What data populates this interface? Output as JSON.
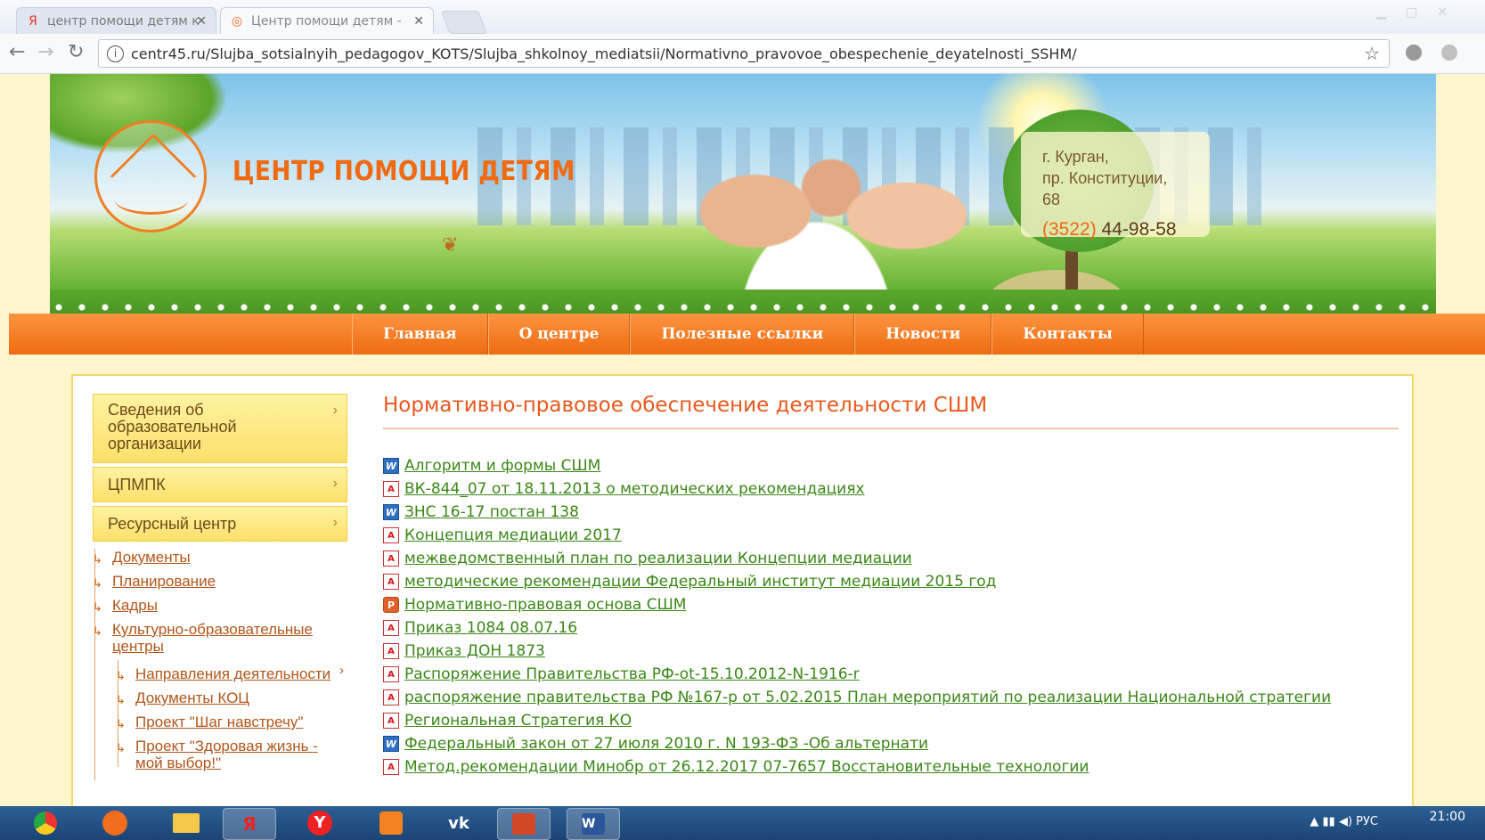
{
  "browser": {
    "tabs": [
      {
        "title": "центр помощи детям к",
        "icon": "yandex-icon"
      },
      {
        "title": "Центр помощи детям -",
        "icon": "site-favicon"
      }
    ],
    "url": "centr45.ru/Slujba_sotsialnyih_pedagogov_KOTS/Slujba_shkolnoy_mediatsii/Normativno_pravovoe_obespechenie_deyatelnosti_SSHM/"
  },
  "header": {
    "site_name": "ЦЕНТР ПОМОЩИ ДЕТЯМ",
    "address_line1": "г. Курган,",
    "address_line2": "пр. Конституции, 68",
    "phone_code": "(3522)",
    "phone_number": "44-98-58"
  },
  "nav": [
    "Главная",
    "О центре",
    "Полезные ссылки",
    "Новости",
    "Контакты"
  ],
  "sidebar": {
    "buttons": [
      "Сведения об образовательной организации",
      "ЦПМПК",
      "Ресурсный центр"
    ],
    "links": [
      "Документы",
      "Планирование",
      "Кадры",
      "Культурно-образовательные центры"
    ],
    "sublinks": [
      "Направления деятельности",
      "Документы КОЦ",
      "Проект \"Шаг навстречу\"",
      "Проект \"Здоровая жизнь - мой выбор!\""
    ]
  },
  "main": {
    "title": "Нормативно-правовое обеспечение деятельности СШМ",
    "documents": [
      {
        "type": "word",
        "name": "Алгоритм и формы СШМ"
      },
      {
        "type": "pdf",
        "name": "ВК-844_07 от 18.11.2013 о методических рекомендациях"
      },
      {
        "type": "word",
        "name": "ЗНС 16-17 постан 138"
      },
      {
        "type": "pdf",
        "name": "Концепция медиации 2017"
      },
      {
        "type": "pdf",
        "name": "межведомственный план по реализации Концепции медиации"
      },
      {
        "type": "pdf",
        "name": "методические рекомендации Федеральный институт медиации 2015 год"
      },
      {
        "type": "ppt",
        "name": "Нормативно-правовая основа СШМ"
      },
      {
        "type": "pdf",
        "name": "Приказ 1084 08.07.16"
      },
      {
        "type": "pdf",
        "name": "Приказ ДОН 1873"
      },
      {
        "type": "pdf",
        "name": "Распоряжение Правительства РФ-ot-15.10.2012-N-1916-r"
      },
      {
        "type": "pdf",
        "name": "распоряжение правительства РФ №167-р от 5.02.2015 План мероприятий по реализации Национальной стратегии"
      },
      {
        "type": "pdf",
        "name": "Региональная Стратегия КО"
      },
      {
        "type": "word",
        "name": "Федеральный закон от 27 июля 2010 г. N 193-ФЗ -Об альтернати"
      },
      {
        "type": "pdf",
        "name": "Метод.рекомендации Минобр от 26.12.2017 07-7657 Восстановительные технологии"
      }
    ]
  },
  "taskbar": {
    "language": "РУС",
    "time": "21:00"
  },
  "colors": {
    "accent": "#ef6a12",
    "link": "#3b8717",
    "sidebar_link": "#b1561a"
  }
}
